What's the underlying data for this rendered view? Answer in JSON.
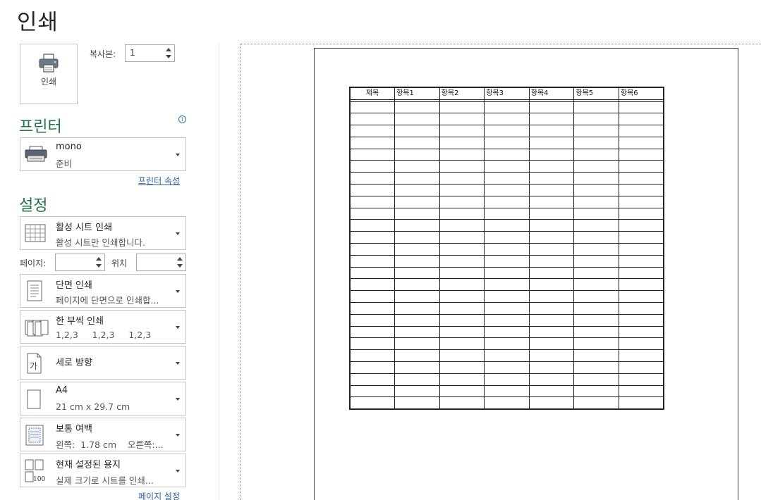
{
  "page_title": "인쇄",
  "print_button": {
    "label": "인쇄",
    "icon": "printer-icon"
  },
  "copies": {
    "label": "복사본:",
    "value": "1"
  },
  "printer": {
    "section_title": "프린터",
    "name": "mono",
    "status": "준비",
    "properties_link": "프린터 속성",
    "info_icon": "info-icon"
  },
  "settings": {
    "section_title": "설정",
    "scope": {
      "title": "활성 시트 인쇄",
      "subtitle": "활성 시트만 인쇄합니다."
    },
    "pages_label": "페이지:",
    "pages_from": "",
    "to_label": "위치",
    "pages_to": "",
    "sides": {
      "title": "단면 인쇄",
      "subtitle": "페이지에 단면으로 인쇄합..."
    },
    "collation": {
      "title": "한 부씩 인쇄",
      "subtitle": "1,2,3     1,2,3     1,2,3"
    },
    "orientation": {
      "title": "세로 방향"
    },
    "paper": {
      "title": "A4",
      "subtitle": "21 cm x 29.7 cm"
    },
    "margins": {
      "title": "보통 여백",
      "subtitle": "왼쪽:  1.78 cm    오른쪽:..."
    },
    "scaling": {
      "title": "현재 설정된 용지",
      "subtitle": "실제 크기로 시트를 인쇄...",
      "icon_text": "100"
    },
    "page_setup_link": "페이지 설정"
  },
  "preview": {
    "headers": [
      "제목",
      "항목1",
      "항목2",
      "항목3",
      "항목4",
      "항목5",
      "항목6"
    ],
    "empty_rows": 26
  }
}
